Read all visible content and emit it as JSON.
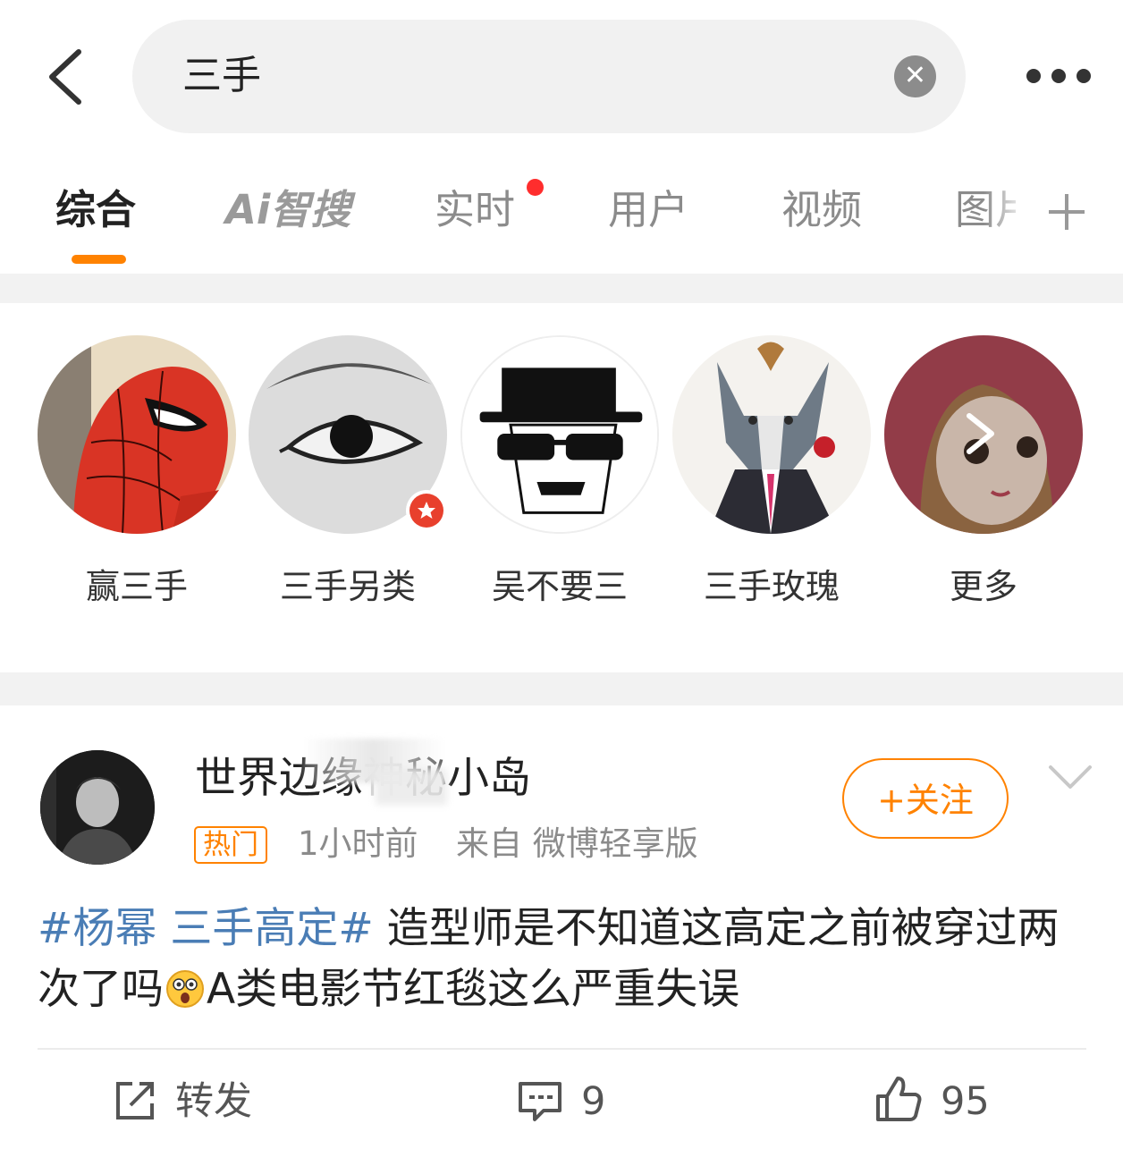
{
  "search": {
    "query": "三手",
    "clear_symbol": "✕"
  },
  "tabs": [
    {
      "label": "综合",
      "active": true
    },
    {
      "label": "智搜",
      "prefix": "Ai"
    },
    {
      "label": "实时",
      "has_new_dot": true
    },
    {
      "label": "用户"
    },
    {
      "label": "视频"
    },
    {
      "label": "图片",
      "visible_text": "图片"
    }
  ],
  "users": [
    {
      "name": "赢三手",
      "avatar": "spiderman-avatar"
    },
    {
      "name": "三手另类",
      "avatar": "eye-avatar",
      "verified_badge": true
    },
    {
      "name": "吴不要三",
      "avatar": "heisenberg-avatar"
    },
    {
      "name": "三手玫瑰",
      "avatar": "wolf-avatar"
    },
    {
      "name": "更多",
      "avatar": "red-hood-avatar"
    }
  ],
  "post": {
    "username_part1": "世界边缘",
    "username_part2": "秘小岛",
    "badge": "热门",
    "time": "1小时前",
    "source": "来自 微博轻享版",
    "follow_label": "+关注",
    "topic": "#杨幂 三手高定#",
    "text_part1": "造型师是不知道这高定之前被穿过两次了吗",
    "text_part2": "A类电影节红毯这么严重失误",
    "actions": {
      "repost_label": "转发",
      "comments": "9",
      "likes": "95"
    }
  },
  "colors": {
    "accent": "#ff8200",
    "topic": "#4a7db5",
    "new_dot": "#ff2d2d"
  }
}
